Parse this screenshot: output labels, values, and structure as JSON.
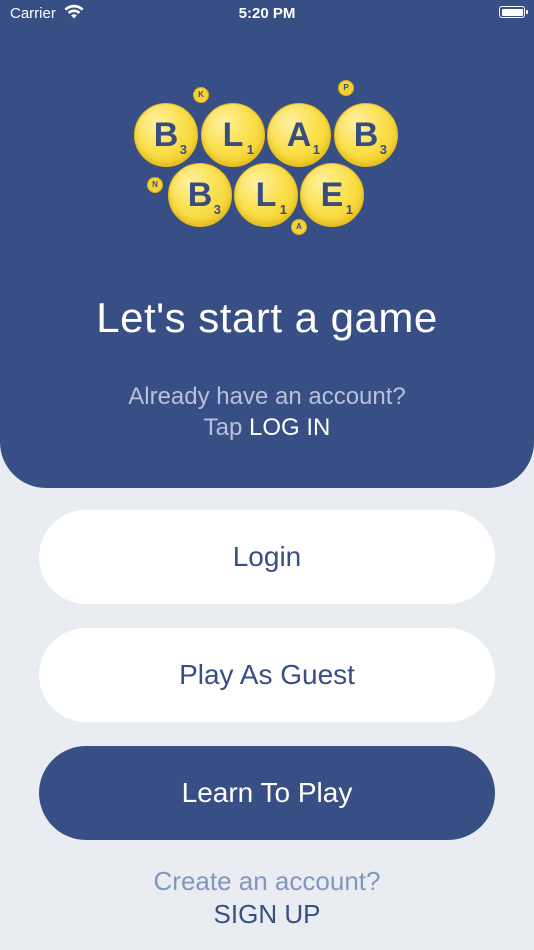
{
  "status_bar": {
    "carrier": "Carrier",
    "time": "5:20 PM",
    "wifi_icon": "wifi-icon",
    "battery_icon": "battery-icon"
  },
  "logo": {
    "row1": [
      {
        "letter": "B",
        "score": "3"
      },
      {
        "letter": "L",
        "score": "1"
      },
      {
        "letter": "A",
        "score": "1"
      },
      {
        "letter": "B",
        "score": "3"
      }
    ],
    "row2": [
      {
        "letter": "B",
        "score": "3"
      },
      {
        "letter": "L",
        "score": "1"
      },
      {
        "letter": "E",
        "score": "1"
      }
    ],
    "mini_tiles": [
      "K",
      "P",
      "N",
      "A"
    ],
    "colors": {
      "tile": "#f7d83a",
      "letter": "#374c80"
    }
  },
  "hero": {
    "headline": "Let's start a game",
    "account_prompt": "Already have an account?",
    "tap_prefix": "Tap",
    "login_link": "LOG IN"
  },
  "buttons": {
    "login": "Login",
    "guest": "Play As Guest",
    "learn": "Learn To Play"
  },
  "footer": {
    "create_prompt": "Create an account?",
    "signup": "SIGN UP"
  },
  "colors": {
    "primary": "#384f85",
    "background": "#e9edf2",
    "muted_text": "#b7c1d9"
  }
}
